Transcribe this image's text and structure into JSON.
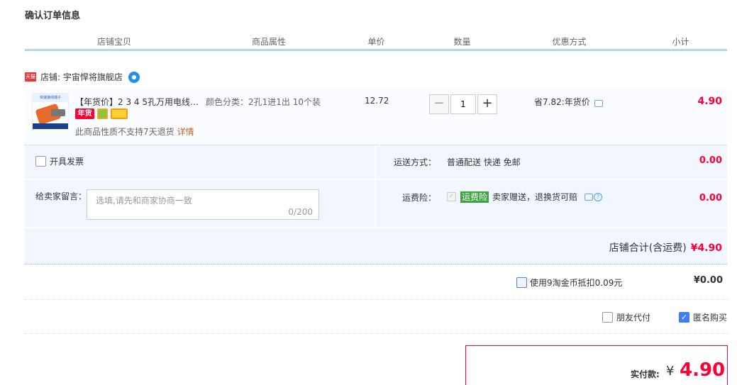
{
  "page_title": "确认订单信息",
  "columns": [
    "店铺宝贝",
    "商品属性",
    "单价",
    "数量",
    "优惠方式",
    "小计"
  ],
  "shop": {
    "tmall_badge": "天猫",
    "label": "店铺: 宇宙悍将旗舰店"
  },
  "item": {
    "thumb_text": "快速接线端子",
    "name": "【年货价】2 3 4 5孔万用电线…",
    "badge_nianhuo": "年货",
    "attribute": "颜色分类：2孔1进1出 10个装",
    "price": "12.72",
    "quantity": "1",
    "minus": "−",
    "plus": "+",
    "promo": "省7.82:年货价",
    "subtotal": "4.90",
    "no_refund": "此商品性质不支持7天退货",
    "detail_link": "详情"
  },
  "options": {
    "invoice_label": "开具发票",
    "message_label": "给卖家留言：",
    "message_placeholder": "选填,请先和商家协商一致",
    "message_count": "0/200",
    "shipping_label": "运送方式：",
    "shipping_value": "普通配送 快递 免邮",
    "shipping_price": "0.00",
    "insurance_label": "运费险：",
    "insurance_tag": "运费险",
    "insurance_text": "卖家赠送，退换货可赔",
    "insurance_price": "0.00",
    "shop_total_label": "店铺合计(含运费)",
    "shop_total_value": "¥4.90"
  },
  "coins": {
    "label": "使用9淘金币抵扣0.09元",
    "value": "¥0.00"
  },
  "friend_pay": "朋友代付",
  "anonymous": "匿名购买",
  "payment": {
    "label": "实付款:",
    "currency": "¥",
    "amount": "4.90"
  },
  "colors": {
    "accent_red": "#ff0036",
    "header_border": "#b2d1ff",
    "option_bg": "#f2f7ff"
  }
}
